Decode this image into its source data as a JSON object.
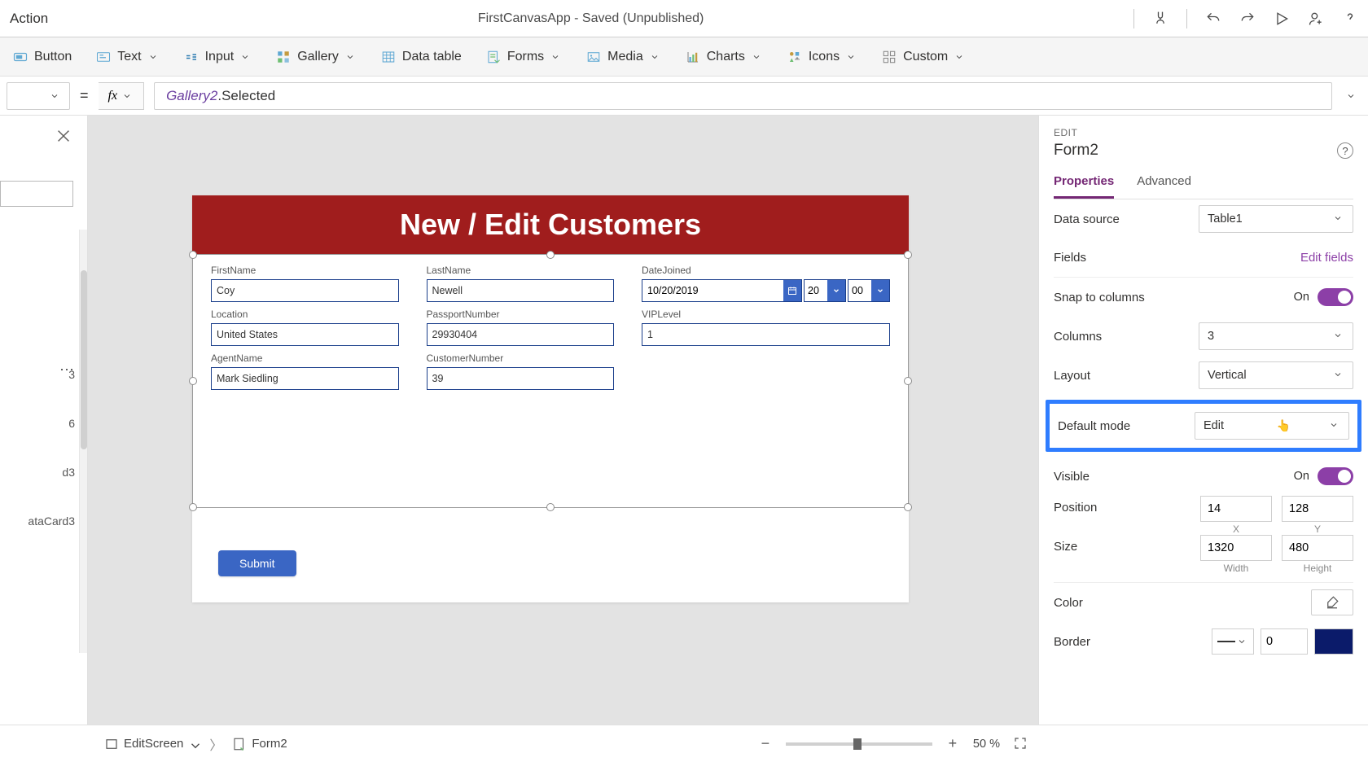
{
  "titlebar": {
    "left_label": "Action",
    "app_status": "FirstCanvasApp - Saved (Unpublished)"
  },
  "ribbon": {
    "button": "Button",
    "text": "Text",
    "input": "Input",
    "gallery": "Gallery",
    "data_table": "Data table",
    "forms": "Forms",
    "media": "Media",
    "charts": "Charts",
    "icons": "Icons",
    "custom": "Custom"
  },
  "formula": {
    "object": "Gallery2",
    "prop": ".Selected"
  },
  "tree": {
    "partials": [
      "3",
      "6",
      "d3",
      "ataCard3"
    ]
  },
  "canvas": {
    "header_title": "New / Edit Customers",
    "fields": {
      "first_name": {
        "label": "FirstName",
        "value": "Coy"
      },
      "last_name": {
        "label": "LastName",
        "value": "Newell"
      },
      "date_joined": {
        "label": "DateJoined",
        "value": "10/20/2019",
        "hour": "20",
        "minute": "00"
      },
      "location": {
        "label": "Location",
        "value": "United States"
      },
      "passport_number": {
        "label": "PassportNumber",
        "value": "29930404"
      },
      "vip_level": {
        "label": "VIPLevel",
        "value": "1"
      },
      "agent_name": {
        "label": "AgentName",
        "value": "Mark Siedling"
      },
      "customer_number": {
        "label": "CustomerNumber",
        "value": "39"
      }
    },
    "submit_label": "Submit"
  },
  "properties": {
    "mode_label": "EDIT",
    "title": "Form2",
    "tabs": {
      "properties": "Properties",
      "advanced": "Advanced"
    },
    "data_source": {
      "label": "Data source",
      "value": "Table1"
    },
    "fields": {
      "label": "Fields",
      "link": "Edit fields"
    },
    "snap": {
      "label": "Snap to columns",
      "state": "On"
    },
    "columns": {
      "label": "Columns",
      "value": "3"
    },
    "layout": {
      "label": "Layout",
      "value": "Vertical"
    },
    "default_mode": {
      "label": "Default mode",
      "value": "Edit"
    },
    "visible": {
      "label": "Visible",
      "state": "On"
    },
    "position": {
      "label": "Position",
      "x": "14",
      "y": "128",
      "x_label": "X",
      "y_label": "Y"
    },
    "size": {
      "label": "Size",
      "w": "1320",
      "h": "480",
      "w_label": "Width",
      "h_label": "Height"
    },
    "color": {
      "label": "Color"
    },
    "border": {
      "label": "Border",
      "width": "0"
    }
  },
  "breadcrumb": {
    "screen": "EditScreen",
    "element": "Form2"
  },
  "zoom": {
    "value": "50",
    "unit": "%"
  }
}
